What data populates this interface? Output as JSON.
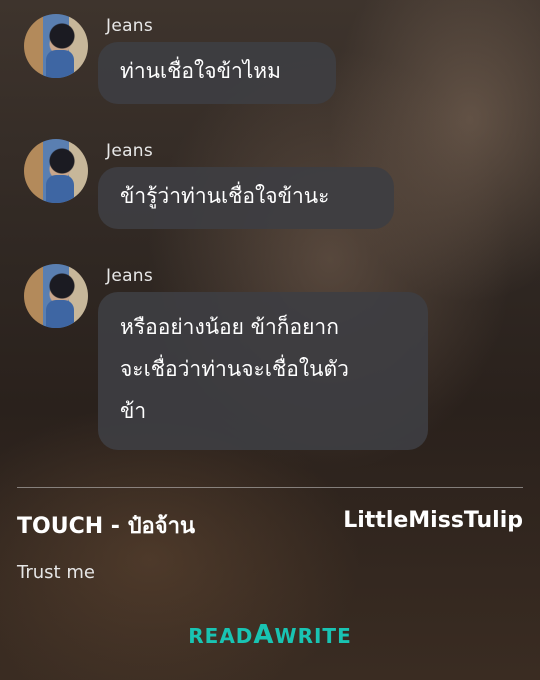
{
  "chat": {
    "messages": [
      {
        "sender": "Jeans",
        "text": "ท่านเชื่อใจข้าไหม"
      },
      {
        "sender": "Jeans",
        "text": "ข้ารู้ว่าท่านเชื่อใจข้านะ"
      },
      {
        "sender": "Jeans",
        "lines": [
          "หรืออย่างน้อย ข้าก็อยาก",
          "จะเชื่อว่าท่านจะเชื่อในตัว",
          "ข้า"
        ]
      }
    ]
  },
  "footer": {
    "story_title": "TOUCH - ป๋อจ้าน",
    "author": "LittleMissTulip",
    "subtitle": "Trust me",
    "logo": {
      "part1": "READ",
      "part2": "A",
      "part3": "WRITE",
      "color": "#19c4b3"
    }
  }
}
